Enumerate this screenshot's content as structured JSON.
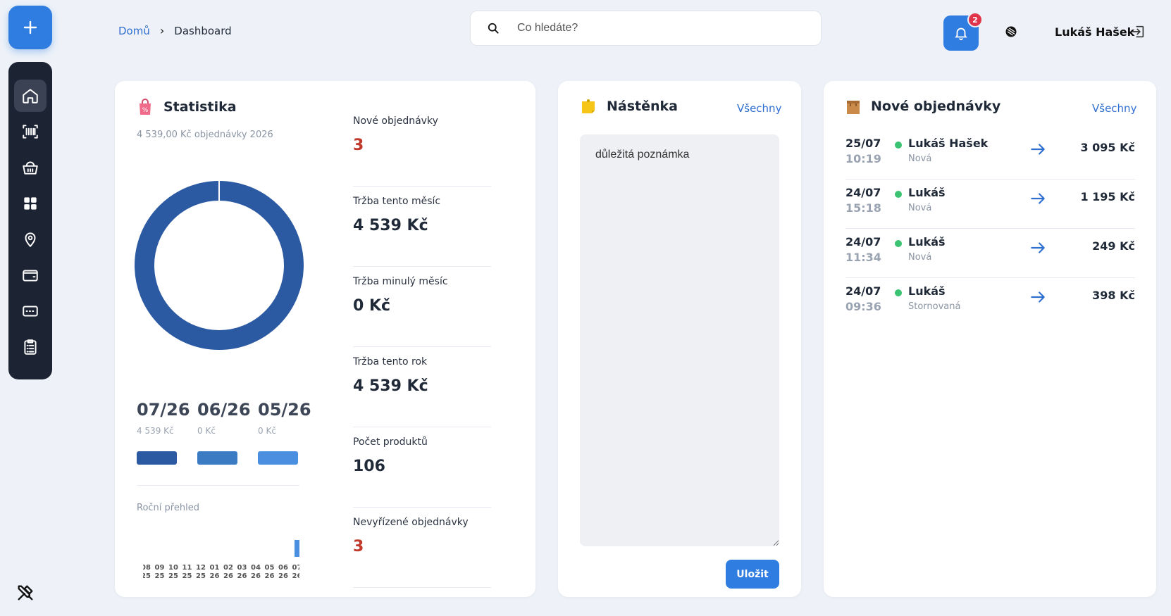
{
  "header": {
    "breadcrumb": {
      "home": "Domů",
      "current": "Dashboard"
    },
    "search_placeholder": "Co hledáte?",
    "notifications_count": "2",
    "user_name": "Lukáš Hašek"
  },
  "colors": {
    "accent": "#2f7de1",
    "donut": "#2b5aa3",
    "bar_dark": "#2b5aa3",
    "bar_mid": "#3b7bc4",
    "bar_light": "#4a8fe0",
    "status_red": "#c0392b",
    "status_green": "#3cc372"
  },
  "sidebar": {
    "items": [
      {
        "name": "home-icon",
        "active": true
      },
      {
        "name": "barcode-icon"
      },
      {
        "name": "basket-icon"
      },
      {
        "name": "grid-icon"
      },
      {
        "name": "location-pin-icon"
      },
      {
        "name": "wallet-icon"
      },
      {
        "name": "card-icon"
      },
      {
        "name": "clipboard-list-icon"
      }
    ]
  },
  "stats": {
    "title": "Statistika",
    "subtitle": "4 539,00 Kč objednávky 2026",
    "donut_share": 1,
    "months": [
      {
        "label": "07/26",
        "value": "4 539 Kč"
      },
      {
        "label": "06/26",
        "value": "0 Kč"
      },
      {
        "label": "05/26",
        "value": "0 Kč"
      }
    ],
    "yearly_label": "Roční přehled",
    "kpis": [
      {
        "label": "Nové objednávky",
        "value": "3",
        "red": true
      },
      {
        "label": "Tržba tento měsíc",
        "value": "4 539 Kč"
      },
      {
        "label": "Tržba minulý měsíc",
        "value": "0 Kč"
      },
      {
        "label": "Tržba tento rok",
        "value": "4 539 Kč"
      },
      {
        "label": "Počet produktů",
        "value": "106"
      },
      {
        "label": "Nevyřízené objednávky",
        "value": "3",
        "red": true
      }
    ]
  },
  "chart_data": {
    "type": "bar",
    "categories": [
      "08/25",
      "09/25",
      "10/25",
      "11/25",
      "12/25",
      "01/26",
      "02/26",
      "03/26",
      "04/26",
      "05/26",
      "06/26",
      "07/26"
    ],
    "tick_top": [
      "08",
      "09",
      "10",
      "11",
      "12",
      "01",
      "02",
      "03",
      "04",
      "05",
      "06",
      "07"
    ],
    "tick_bottom": [
      "25",
      "25",
      "25",
      "25",
      "25",
      "26",
      "26",
      "26",
      "26",
      "26",
      "26",
      "26"
    ],
    "values": [
      0,
      0,
      0,
      0,
      0,
      0,
      0,
      0,
      0,
      0,
      0,
      4539
    ],
    "title": "Roční přehled",
    "xlabel": "",
    "ylabel": "",
    "ylim": [
      0,
      4539
    ]
  },
  "board": {
    "title": "Nástěnka",
    "link": "Všechny",
    "note": "důležitá poznámka",
    "save_label": "Uložit"
  },
  "orders": {
    "title": "Nové objednávky",
    "link": "Všechny",
    "rows": [
      {
        "date": "25/07",
        "time": "10:19",
        "name": "Lukáš Hašek",
        "status": "Nová",
        "price": "3 095 Kč"
      },
      {
        "date": "24/07",
        "time": "15:18",
        "name": "Lukáš",
        "status": "Nová",
        "price": "1 195 Kč"
      },
      {
        "date": "24/07",
        "time": "11:34",
        "name": "Lukáš",
        "status": "Nová",
        "price": "249 Kč"
      },
      {
        "date": "24/07",
        "time": "09:36",
        "name": "Lukáš",
        "status": "Stornovaná",
        "price": "398 Kč"
      }
    ]
  }
}
